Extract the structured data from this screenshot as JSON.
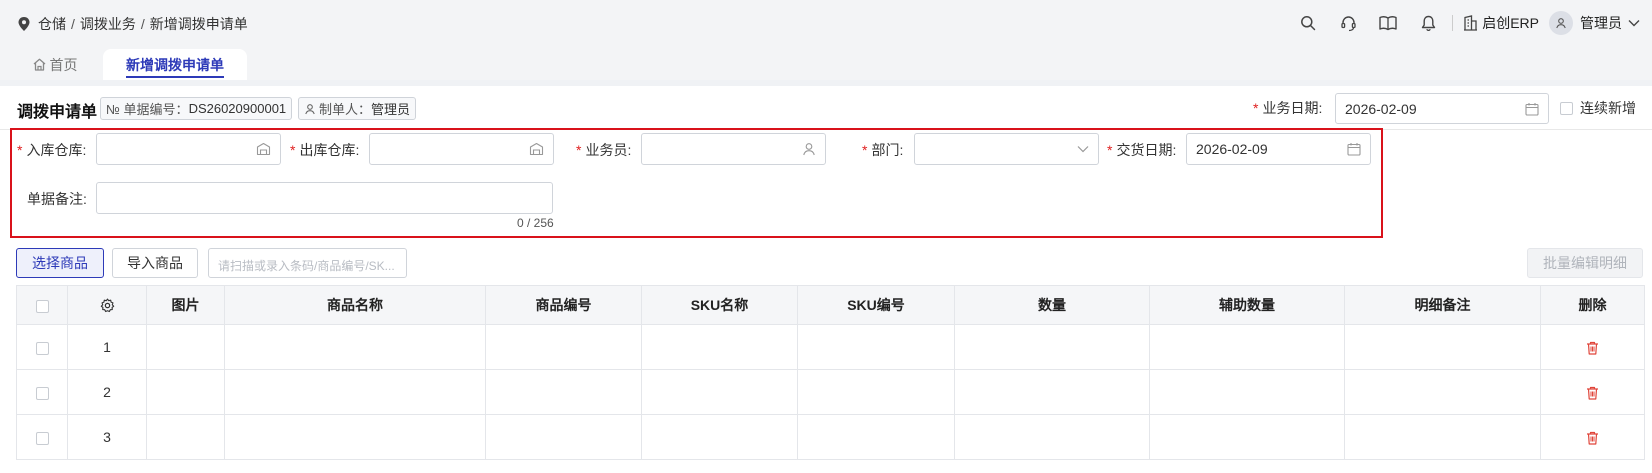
{
  "breadcrumb": {
    "items": [
      "仓储",
      "调拨业务",
      "新增调拨申请单"
    ],
    "separator": "/"
  },
  "header": {
    "company": "启创ERP",
    "user": "管理员"
  },
  "tabs": [
    {
      "label": "首页",
      "active": false
    },
    {
      "label": "新增调拨申请单",
      "active": true
    }
  ],
  "doc": {
    "title": "调拨申请单",
    "number_label": "№ 单据编号：",
    "number_value": "DS26020900001",
    "creator_label": "制单人：",
    "creator_value": "管理员",
    "biz_date_label": "业务日期:",
    "biz_date_value": "2026-02-09",
    "continuous_label": "连续新增"
  },
  "form": {
    "required_mark": "*",
    "in_warehouse_label": "入库仓库:",
    "in_warehouse_value": "",
    "out_warehouse_label": "出库仓库:",
    "out_warehouse_value": "",
    "salesperson_label": "业务员:",
    "salesperson_value": "",
    "department_label": "部门:",
    "department_value": "",
    "delivery_date_label": "交货日期:",
    "delivery_date_value": "2026-02-09",
    "remark_label": "单据备注:",
    "remark_value": "",
    "remark_counter": "0 / 256"
  },
  "toolbar": {
    "select_goods": "选择商品",
    "import_goods": "导入商品",
    "scan_placeholder": "请扫描或录入条码/商品编号/SK...",
    "batch_edit": "批量编辑明细"
  },
  "table": {
    "columns": [
      "图片",
      "商品名称",
      "商品编号",
      "SKU名称",
      "SKU编号",
      "数量",
      "辅助数量",
      "明细备注",
      "删除"
    ],
    "rows": [
      "1",
      "2",
      "3"
    ]
  },
  "colors": {
    "accent": "#2d3ab8",
    "required": "#e02020",
    "highlight_border": "#d9121b",
    "delete": "#e0453a"
  }
}
